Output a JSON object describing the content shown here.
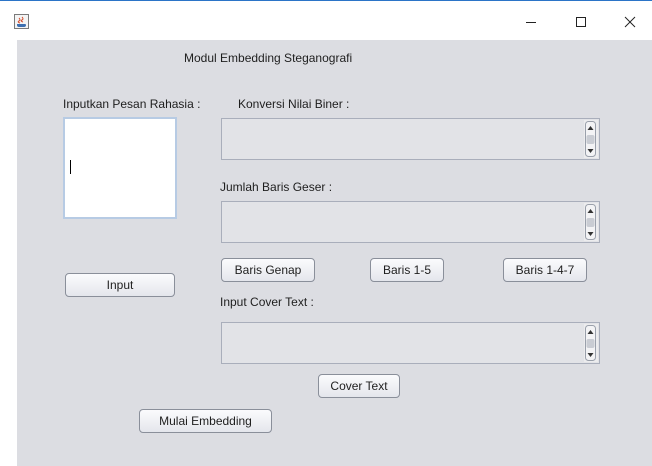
{
  "window": {
    "controls": {
      "minimize_icon": "minimize-icon",
      "maximize_icon": "maximize-icon",
      "close_icon": "close-icon"
    }
  },
  "labels": {
    "title": "Modul Embedding Steganografi",
    "pesan": "Inputkan Pesan Rahasia :",
    "konversi": "Konversi Nilai Biner :",
    "jumlah": "Jumlah Baris Geser :",
    "cover": "Input Cover Text :"
  },
  "fields": {
    "pesan_value": "",
    "konversi_value": "",
    "jumlah_value": "",
    "cover_value": ""
  },
  "buttons": {
    "input": "Input",
    "baris_genap": "Baris Genap",
    "baris_1_5": "Baris 1-5",
    "baris_1_4_7": "Baris 1-4-7",
    "cover_text": "Cover Text",
    "mulai": "Mulai Embedding"
  },
  "colors": {
    "panel": "#dcdde2",
    "accent": "#2b74c7"
  }
}
